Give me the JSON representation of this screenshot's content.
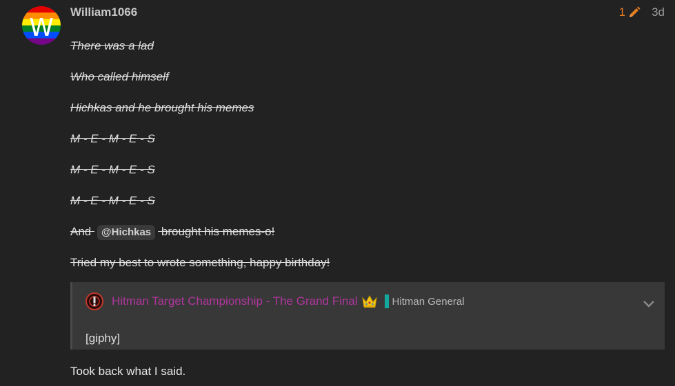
{
  "post": {
    "username": "William1066",
    "avatar_letter": "W",
    "edit_count": "1",
    "date": "3d",
    "lines": [
      "There was a lad",
      "Who called himself",
      "Hichkas and he brought his memes",
      "M - E - M - E - S",
      "M - E - M - E - S",
      "M - E - M - E - S"
    ],
    "mention_line": {
      "before": "And",
      "mention": "@Hichkas",
      "after": "brought his memes-o!"
    },
    "birthday_line": "Tried my best to wrote something, happy birthday!",
    "quote": {
      "topic_title": "Hitman Target Championship - The Grand Final",
      "category": "Hitman General",
      "category_color": "#12a89d",
      "topic_color": "#b0369d",
      "content": "[giphy]",
      "emoji": "crown"
    },
    "closing": "Took back what I said."
  },
  "colors": {
    "background": "#222222",
    "edit_accent": "#e67e22"
  },
  "icons": [
    "pencil-icon",
    "chevron-down-icon",
    "crown-emoji",
    "hitman-logo-icon"
  ]
}
